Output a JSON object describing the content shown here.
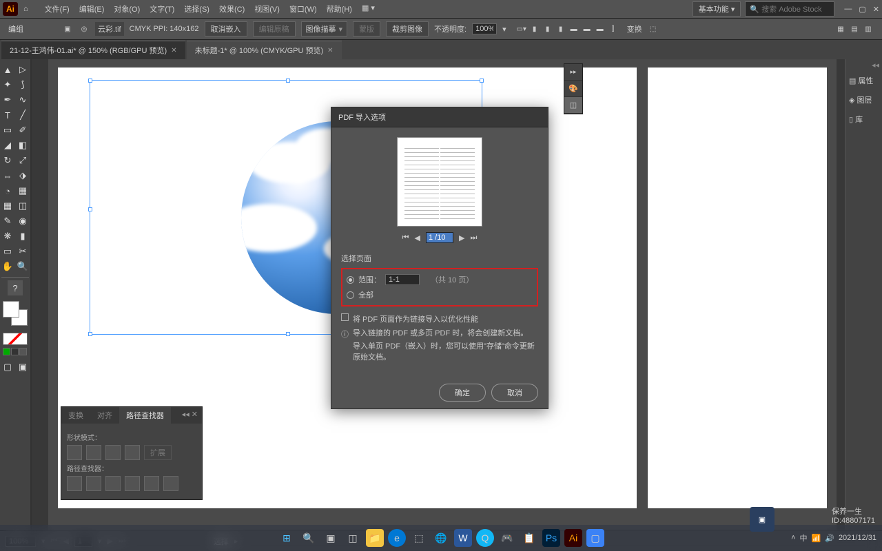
{
  "menubar": {
    "items": [
      "文件(F)",
      "编辑(E)",
      "对象(O)",
      "文字(T)",
      "选择(S)",
      "效果(C)",
      "视图(V)",
      "窗口(W)",
      "帮助(H)"
    ]
  },
  "workspace_label": "基本功能",
  "search_placeholder": "搜索 Adobe Stock",
  "control": {
    "group_label": "编组",
    "filename": "云彩.tif",
    "colormode": "CMYK PPI: 140x162",
    "cancel_embed": "取消嵌入",
    "edit_orig": "编辑原稿",
    "img_trace": "图像描摹",
    "mask": "蒙版",
    "crop": "裁剪图像",
    "opacity_label": "不透明度:",
    "opacity_value": "100%",
    "transform": "变换"
  },
  "tabs": [
    {
      "label": "21-12-王鸿伟-01.ai* @ 150% (RGB/GPU 预览)"
    },
    {
      "label": "未标题-1* @ 100% (CMYK/GPU 预览)"
    }
  ],
  "right_panel": {
    "items": [
      "属性",
      "图层",
      "库"
    ]
  },
  "dialog": {
    "title": "PDF 导入选项",
    "page_nav": "1 /10",
    "select_pages": "选择页面",
    "range_label": "范围：",
    "range_value": "1-1",
    "total_hint": "（共 10 页）",
    "all_label": "全部",
    "link_checkbox": "将 PDF 页面作为链接导入以优化性能",
    "info1": "导入链接的 PDF 或多页 PDF 时，将会创建新文档。",
    "info2": "导入单页 PDF（嵌入）时，您可以使用\"存储\"命令更新原始文档。",
    "ok": "确定",
    "cancel": "取消"
  },
  "pathfinder": {
    "tabs": [
      "变换",
      "对齐",
      "路径查找器"
    ],
    "shape_mode": "形状模式：",
    "expand": "扩展",
    "pathfinders": "路径查找器："
  },
  "status": {
    "zoom": "100%",
    "page": "1",
    "select": "选择"
  },
  "watermark": {
    "brand": "保养一生",
    "id": "ID:48807171"
  },
  "tb_time": "2021/12/31"
}
